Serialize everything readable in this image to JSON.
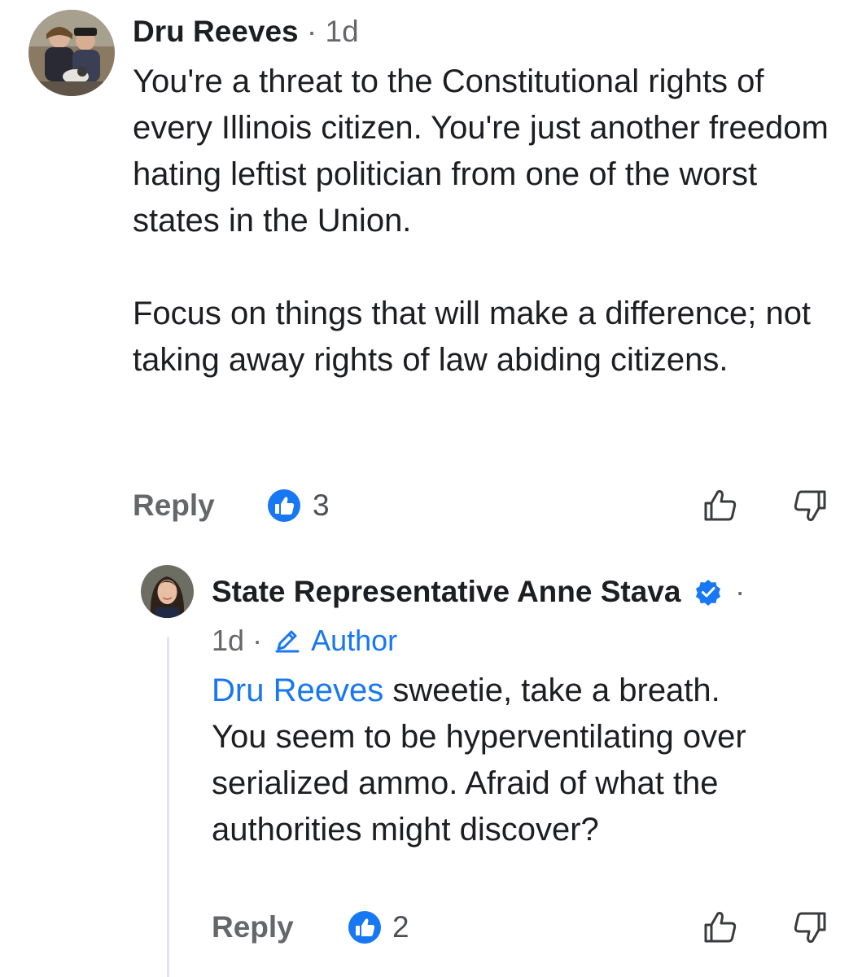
{
  "comment": {
    "author": "Dru Reeves",
    "separator": "·",
    "time": "1d",
    "body": "You're a threat to the Constitutional rights of every Illinois citizen. You're just another freedom hating leftist politician from one of the worst states in the Union.\n\nFocus on things that will make a difference; not taking away rights of law abiding citizens.",
    "reply_label": "Reply",
    "like_count": "3"
  },
  "reply": {
    "author": "State Representative Anne Stava",
    "separator": "·",
    "time": "1d",
    "meta_separator": "·",
    "author_badge": "Author",
    "mention": "Dru Reeves",
    "body": " sweetie, take a breath.\nYou seem to be hyperventilating over serialized ammo. Afraid of what the authorities might discover?",
    "reply_label": "Reply",
    "like_count": "2"
  },
  "icons": {
    "avatar_main": "avatar-photo",
    "avatar_reply": "avatar-photo",
    "like_badge": "thumbs-up-icon",
    "upvote": "thumbs-up-outline-icon",
    "downvote": "thumbs-down-outline-icon",
    "verified": "verified-badge-icon",
    "author_badge": "pencil-icon"
  },
  "colors": {
    "accent": "#1877f2",
    "secondary_text": "#65676b",
    "primary_text": "#1c1e21"
  }
}
